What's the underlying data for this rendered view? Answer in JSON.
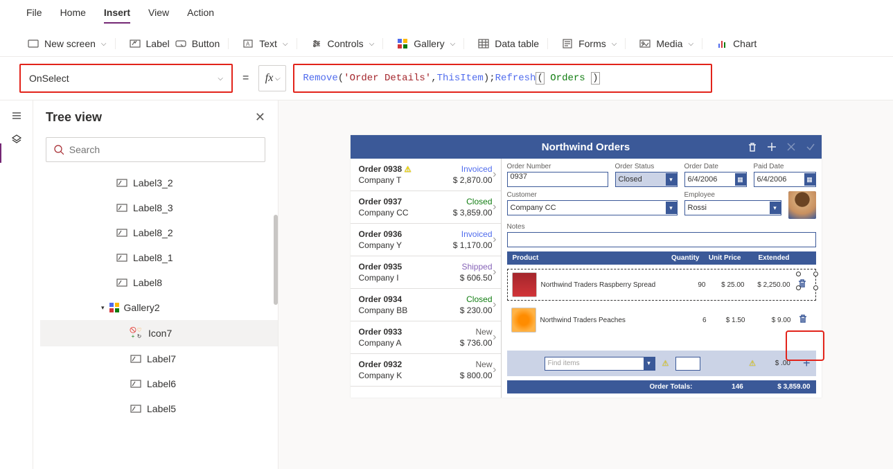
{
  "menu": {
    "items": [
      "File",
      "Home",
      "Insert",
      "View",
      "Action"
    ],
    "active": 2
  },
  "ribbon": {
    "new_screen": "New screen",
    "label": "Label",
    "button": "Button",
    "text": "Text",
    "controls": "Controls",
    "gallery": "Gallery",
    "data_table": "Data table",
    "forms": "Forms",
    "media": "Media",
    "chart": "Chart"
  },
  "formula": {
    "property": "OnSelect",
    "tokens": {
      "remove": "Remove",
      "order_details": "'Order Details'",
      "this_item": "ThisItem",
      "refresh": "Refresh",
      "orders": "Orders"
    }
  },
  "tree": {
    "title": "Tree view",
    "search_placeholder": "Search",
    "items": [
      {
        "name": "Label3_2",
        "type": "label"
      },
      {
        "name": "Label8_3",
        "type": "label"
      },
      {
        "name": "Label8_2",
        "type": "label"
      },
      {
        "name": "Label8_1",
        "type": "label"
      },
      {
        "name": "Label8",
        "type": "label"
      },
      {
        "name": "Gallery2",
        "type": "gallery",
        "expanded": true
      },
      {
        "name": "Icon7",
        "type": "icon",
        "selected": true
      },
      {
        "name": "Label7",
        "type": "label"
      },
      {
        "name": "Label6",
        "type": "label"
      },
      {
        "name": "Label5",
        "type": "label"
      }
    ]
  },
  "app": {
    "title": "Northwind Orders",
    "orders": [
      {
        "id": "Order 0938",
        "company": "Company T",
        "status": "Invoiced",
        "amount": "$ 2,870.00",
        "warn": true
      },
      {
        "id": "Order 0937",
        "company": "Company CC",
        "status": "Closed",
        "amount": "$ 3,859.00"
      },
      {
        "id": "Order 0936",
        "company": "Company Y",
        "status": "Invoiced",
        "amount": "$ 1,170.00"
      },
      {
        "id": "Order 0935",
        "company": "Company I",
        "status": "Shipped",
        "amount": "$ 606.50"
      },
      {
        "id": "Order 0934",
        "company": "Company BB",
        "status": "Closed",
        "amount": "$ 230.00"
      },
      {
        "id": "Order 0933",
        "company": "Company A",
        "status": "New",
        "amount": "$ 736.00"
      },
      {
        "id": "Order 0932",
        "company": "Company K",
        "status": "New",
        "amount": "$ 800.00"
      }
    ],
    "form": {
      "labels": {
        "order_number": "Order Number",
        "order_status": "Order Status",
        "order_date": "Order Date",
        "paid_date": "Paid Date",
        "customer": "Customer",
        "employee": "Employee",
        "notes": "Notes"
      },
      "order_number": "0937",
      "order_status": "Closed",
      "order_date": "6/4/2006",
      "paid_date": "6/4/2006",
      "customer": "Company CC",
      "employee": "Rossi"
    },
    "details_header": {
      "product": "Product",
      "quantity": "Quantity",
      "unit_price": "Unit Price",
      "extended": "Extended"
    },
    "details": [
      {
        "name": "Northwind Traders Raspberry Spread",
        "qty": "90",
        "unit": "$ 25.00",
        "ext": "$ 2,250.00",
        "img": "raspberry"
      },
      {
        "name": "Northwind Traders Peaches",
        "qty": "6",
        "unit": "$ 1.50",
        "ext": "$ 9.00",
        "img": "peaches"
      }
    ],
    "add_line": {
      "placeholder": "Find items",
      "ext": "$ .00"
    },
    "totals": {
      "label": "Order Totals:",
      "qty": "146",
      "amount": "$ 3,859.00"
    }
  }
}
